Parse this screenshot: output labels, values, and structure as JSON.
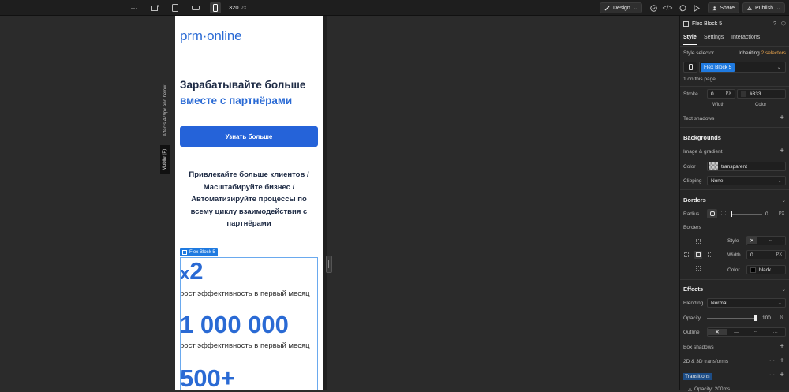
{
  "topbar": {
    "more": "···",
    "breakpoint_width": "320",
    "breakpoint_unit": "PX",
    "mode_label": "Design",
    "share_label": "Share",
    "publish_label": "Publish"
  },
  "canvas": {
    "mobile_label": "Mobile (P)",
    "affects_label": "Affects 479px and below",
    "selected_label": "Flex Block 5"
  },
  "page": {
    "logo_left": "prm",
    "logo_dot": "·",
    "logo_right": "online",
    "headline_1": "Зарабатывайте больше",
    "headline_2": "вместе с партнёрами",
    "cta": "Узнать больше",
    "desc": "Привлекайте больше клиентов / Масштабируйте бизнес / Автоматизируйте процессы по всему циклу взаимодействия с партнёрами",
    "stats": [
      {
        "prefix": "x",
        "value": "2",
        "caption": "рост эффективность в первый месяц"
      },
      {
        "value": "1 000 000",
        "caption": "рост эффективность в первый месяц"
      },
      {
        "value": "500+"
      }
    ]
  },
  "panel": {
    "element_name": "Flex Block 5",
    "tabs": [
      "Style",
      "Settings",
      "Interactions"
    ],
    "style_selector_label": "Style selector",
    "inheriting_label": "Inheriting",
    "inheriting_count": "2 selectors",
    "selector_chip": "Flex Block 5",
    "on_page": "1 on this page",
    "stroke_label": "Stroke",
    "stroke_width": "0",
    "stroke_unit": "PX",
    "stroke_color": "#333",
    "width_caption": "Width",
    "color_caption": "Color",
    "text_shadows": "Text shadows",
    "backgrounds": "Backgrounds",
    "image_gradient": "Image & gradient",
    "color_label": "Color",
    "bg_color_value": "transparent",
    "clipping_label": "Clipping",
    "clipping_value": "None",
    "borders_section": "Borders",
    "radius_label": "Radius",
    "radius_value": "0",
    "radius_unit": "PX",
    "borders_label": "Borders",
    "style_label": "Style",
    "width_label": "Width",
    "border_width": "0",
    "border_unit": "PX",
    "border_color_label": "Color",
    "border_color_value": "black",
    "effects": "Effects",
    "blending_label": "Blending",
    "blending_value": "Normal",
    "opacity_label": "Opacity",
    "opacity_value": "100",
    "opacity_unit": "%",
    "outline_label": "Outline",
    "box_shadows": "Box shadows",
    "transforms": "2D & 3D transforms",
    "transitions": "Transitions",
    "transition_item": "Opacity: 200ms"
  }
}
